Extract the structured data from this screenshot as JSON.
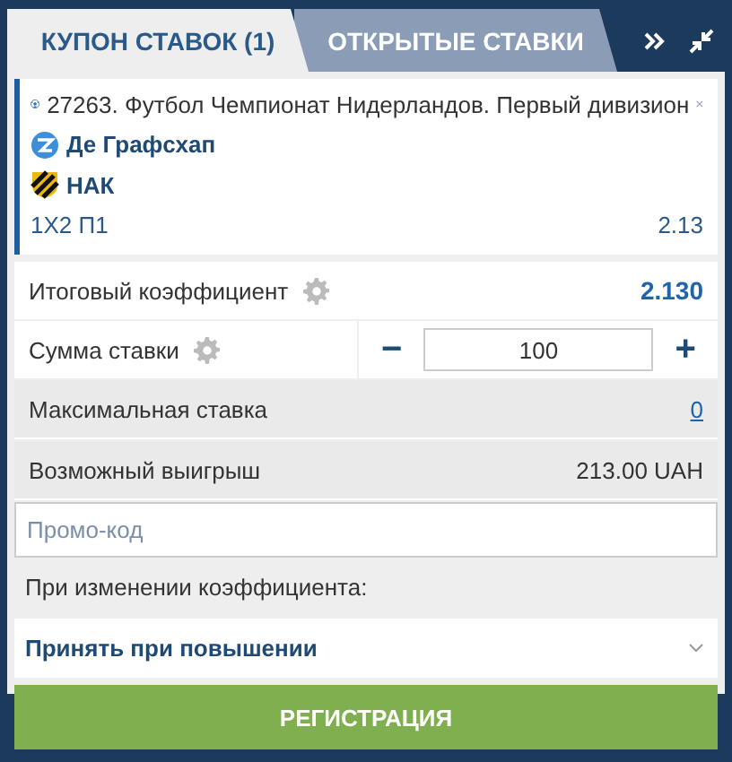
{
  "tabs": [
    {
      "label": "КУПОН СТАВОК (1)",
      "selected": true
    },
    {
      "label": "ОТКРЫТЫЕ СТАВКИ",
      "selected": false
    }
  ],
  "bet": {
    "event": "27263. Футбол Чемпионат Нидерландов. Первый дивизион",
    "teams": [
      "Де Графсхап",
      "НАК"
    ],
    "market": "1X2 П1",
    "odds": "2.13"
  },
  "total_odds": {
    "label": "Итоговый коэффициент",
    "value": "2.130"
  },
  "stake": {
    "label": "Сумма ставки",
    "minus": "−",
    "value": "100",
    "plus": "+"
  },
  "max_stake": {
    "label": "Максимальная ставка",
    "value": "0"
  },
  "possible_win": {
    "label": "Возможный выигрыш",
    "value": "213.00 UAH"
  },
  "promo": {
    "placeholder": "Промо-код"
  },
  "odds_change": {
    "label": "При изменении коэффициента:",
    "value": "Принять при повышении"
  },
  "button": "РЕГИСТРАЦИЯ"
}
